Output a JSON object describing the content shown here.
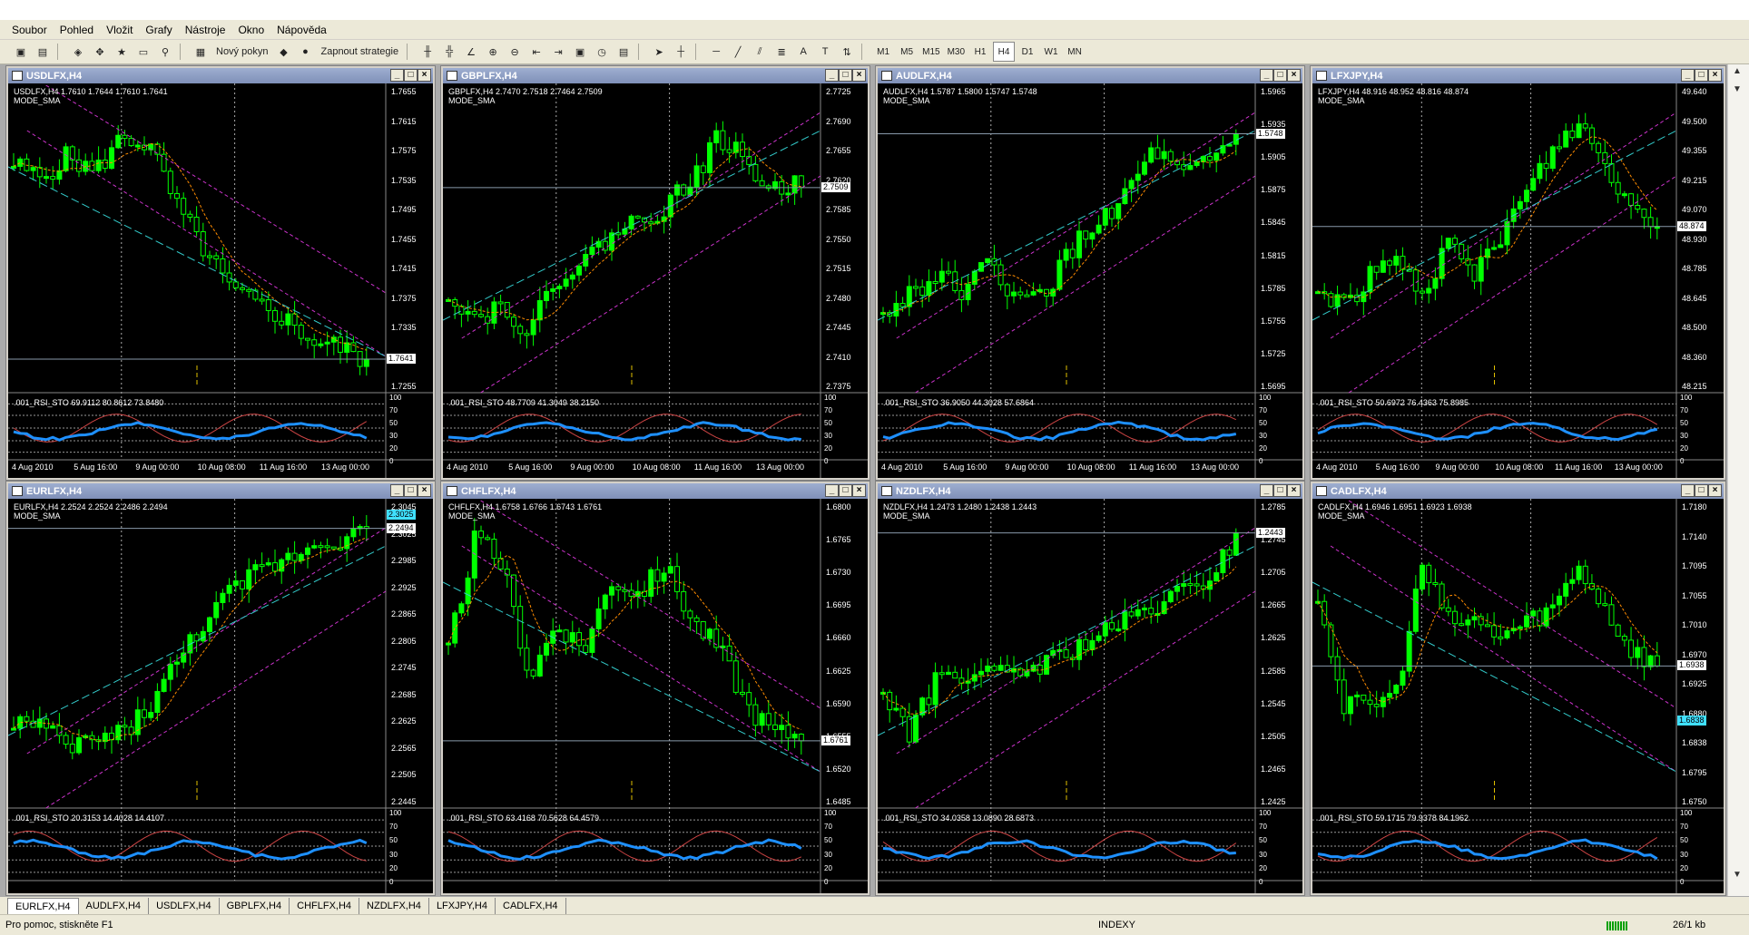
{
  "menu": [
    {
      "label": "Soubor"
    },
    {
      "label": "Pohled"
    },
    {
      "label": "Vložit"
    },
    {
      "label": "Grafy"
    },
    {
      "label": "Nástroje"
    },
    {
      "label": "Okno"
    },
    {
      "label": "Nápověda"
    }
  ],
  "toolbar": {
    "new_order_label": "Nový pokyn",
    "strategy_label": "Zapnout strategie",
    "timeframes": [
      "M1",
      "M5",
      "M15",
      "M30",
      "H1",
      "H4",
      "D1",
      "W1",
      "MN"
    ],
    "active_timeframe": "H4"
  },
  "windows": [
    {
      "title": "USDLFX,H4",
      "ohlc": "USDLFX,H4  1.7610 1.7644 1.7610 1.7641",
      "mode": "MODE_SMA",
      "prices": [
        "1.7655",
        "1.7615",
        "1.7575",
        "1.7535",
        "1.7495",
        "1.7455",
        "1.7415",
        "1.7375",
        "1.7335",
        "1.7295",
        "1.7255"
      ],
      "badge": "1.7641",
      "badge_cyan": false,
      "ind": ".001_RSI_STO 69.9112 80.8612 73.8480",
      "ind_levels": [
        "100",
        "70",
        "50",
        "30",
        "20",
        "0"
      ],
      "times": [
        "4 Aug 2010",
        "5 Aug 16:00",
        "9 Aug 00:00",
        "10 Aug 08:00",
        "11 Aug 16:00",
        "13 Aug 00:00"
      ]
    },
    {
      "title": "GBPLFX,H4",
      "ohlc": "GBPLFX,H4  2.7470 2.7518 2.7464 2.7509",
      "mode": "MODE_SMA",
      "prices": [
        "2.7725",
        "2.7690",
        "2.7655",
        "2.7620",
        "2.7585",
        "2.7550",
        "2.7515",
        "2.7480",
        "2.7445",
        "2.7410",
        "2.7375"
      ],
      "badge": "2.7509",
      "badge_cyan": false,
      "ind": ".001_RSI_STO 48.7709 41.3049 38.2150",
      "ind_levels": [
        "100",
        "70",
        "50",
        "30",
        "20",
        "0"
      ],
      "times": [
        "4 Aug 2010",
        "5 Aug 16:00",
        "9 Aug 00:00",
        "10 Aug 08:00",
        "11 Aug 16:00",
        "13 Aug 00:00"
      ]
    },
    {
      "title": "AUDLFX,H4",
      "ohlc": "AUDLFX,H4  1.5787 1.5800 1.5747 1.5748",
      "mode": "MODE_SMA",
      "prices": [
        "1.5965",
        "1.5935",
        "1.5905",
        "1.5875",
        "1.5845",
        "1.5815",
        "1.5785",
        "1.5755",
        "1.5725",
        "1.5695"
      ],
      "badge": "1.5748",
      "badge_cyan": false,
      "ind": ".001_RSI_STO 36.9050 44.3028 57.6864",
      "ind_levels": [
        "100",
        "70",
        "50",
        "30",
        "20",
        "0"
      ],
      "times": [
        "4 Aug 2010",
        "5 Aug 16:00",
        "9 Aug 00:00",
        "10 Aug 08:00",
        "11 Aug 16:00",
        "13 Aug 00:00"
      ]
    },
    {
      "title": "LFXJPY,H4",
      "ohlc": "LFXJPY,H4  48.916 48.952 48.816 48.874",
      "mode": "MODE_SMA",
      "prices": [
        "49.640",
        "49.500",
        "49.355",
        "49.215",
        "49.070",
        "48.930",
        "48.785",
        "48.645",
        "48.500",
        "48.360",
        "48.215"
      ],
      "badge": "48.874",
      "badge_cyan": false,
      "ind": ".001_RSI_STO 50.6972 76.4363 75.8985",
      "ind_levels": [
        "100",
        "70",
        "50",
        "30",
        "20",
        "0"
      ],
      "times": [
        "4 Aug 2010",
        "5 Aug 16:00",
        "9 Aug 00:00",
        "10 Aug 08:00",
        "11 Aug 16:00",
        "13 Aug 00:00"
      ]
    },
    {
      "title": "EURLFX,H4",
      "ohlc": "EURLFX,H4  2.2524 2.2524 2.2486 2.2494",
      "mode": "MODE_SMA",
      "prices": [
        "2.3045",
        "2.3025",
        "2.2985",
        "2.2925",
        "2.2865",
        "2.2805",
        "2.2745",
        "2.2685",
        "2.2625",
        "2.2565",
        "2.2505",
        "2.2445"
      ],
      "badge": "2.2494",
      "badge_cyan": false,
      "badge2": "2.3025",
      "ind": ".001_RSI_STO 20.3153 14.4028 14.4107",
      "ind_levels": [
        "100",
        "70",
        "50",
        "30",
        "20",
        "0"
      ],
      "times": []
    },
    {
      "title": "CHFLFX,H4",
      "ohlc": "CHFLFX,H4  1.6758 1.6766 1.6743 1.6761",
      "mode": "MODE_SMA",
      "prices": [
        "1.6800",
        "1.6765",
        "1.6730",
        "1.6695",
        "1.6660",
        "1.6625",
        "1.6590",
        "1.6555",
        "1.6520",
        "1.6485"
      ],
      "badge": "1.6761",
      "badge_cyan": false,
      "ind": ".001_RSI_STO 63.4168 70.5628 64.4579",
      "ind_levels": [
        "100",
        "70",
        "50",
        "30",
        "20",
        "0"
      ],
      "times": []
    },
    {
      "title": "NZDLFX,H4",
      "ohlc": "NZDLFX,H4  1.2473 1.2480 1.2438 1.2443",
      "mode": "MODE_SMA",
      "prices": [
        "1.2785",
        "1.2745",
        "1.2705",
        "1.2665",
        "1.2625",
        "1.2585",
        "1.2545",
        "1.2505",
        "1.2465",
        "1.2425"
      ],
      "badge": "1.2443",
      "badge_cyan": false,
      "ind": ".001_RSI_STO 34.0358 13.0890 28.6873",
      "ind_levels": [
        "100",
        "70",
        "50",
        "30",
        "20",
        "0"
      ],
      "times": []
    },
    {
      "title": "CADLFX,H4",
      "ohlc": "CADLFX,H4  1.6946 1.6951 1.6923 1.6938",
      "mode": "MODE_SMA",
      "prices": [
        "1.7180",
        "1.7140",
        "1.7095",
        "1.7055",
        "1.7010",
        "1.6970",
        "1.6925",
        "1.6880",
        "1.6838",
        "1.6795",
        "1.6750"
      ],
      "badge": "1.6938",
      "badge_cyan": false,
      "badge2": "1.6838",
      "ind": ".001_RSI_STO 59.1715 79.9378 84.1962",
      "ind_levels": [
        "100",
        "70",
        "50",
        "30",
        "20",
        "0"
      ],
      "times": []
    }
  ],
  "tabs": [
    "EURLFX,H4",
    "AUDLFX,H4",
    "USDLFX,H4",
    "GBPLFX,H4",
    "CHFLFX,H4",
    "NZDLFX,H4",
    "LFXJPY,H4",
    "CADLFX,H4"
  ],
  "active_tab": "EURLFX,H4",
  "status": {
    "help": "Pro pomoc, stiskněte F1",
    "profile": "INDEXY",
    "traffic": "26/1 kb"
  },
  "colors": {
    "bull": "#00ff00",
    "bear": "#ffffff",
    "ma": "#ff8c00",
    "channel": "#cc33cc",
    "trend": "#33cccc",
    "rsi": "#1e90ff"
  }
}
